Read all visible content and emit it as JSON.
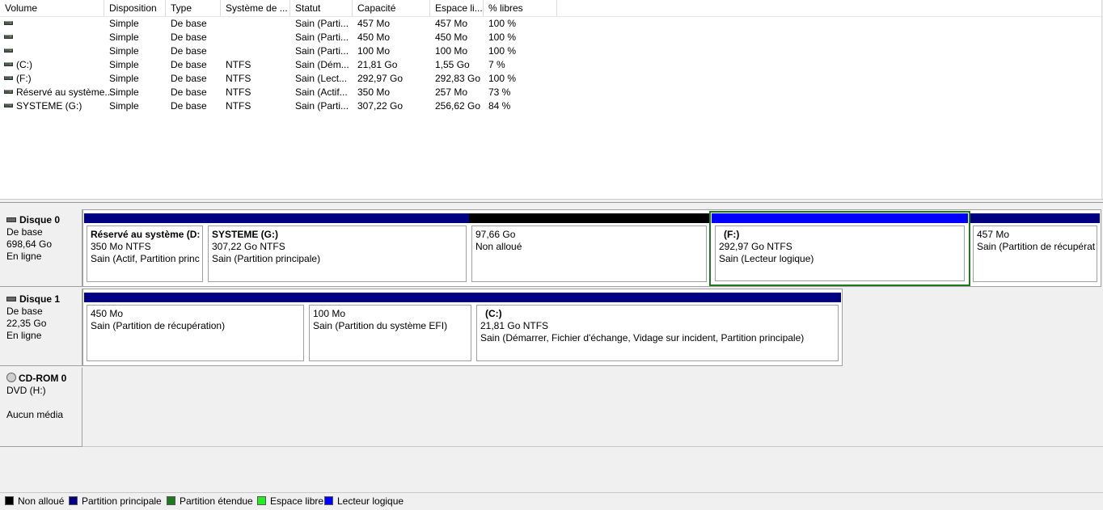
{
  "columns": [
    "Volume",
    "Disposition",
    "Type",
    "Système de ...",
    "Statut",
    "Capacité",
    "Espace li...",
    "% libres"
  ],
  "volumes": [
    {
      "volume": "",
      "disposition": "Simple",
      "type": "De base",
      "fs": "",
      "status": "Sain (Parti...",
      "capacity": "457 Mo",
      "free": "457 Mo",
      "pct": "100 %"
    },
    {
      "volume": "",
      "disposition": "Simple",
      "type": "De base",
      "fs": "",
      "status": "Sain (Parti...",
      "capacity": "450 Mo",
      "free": "450 Mo",
      "pct": "100 %"
    },
    {
      "volume": "",
      "disposition": "Simple",
      "type": "De base",
      "fs": "",
      "status": "Sain (Parti...",
      "capacity": "100 Mo",
      "free": "100 Mo",
      "pct": "100 %"
    },
    {
      "volume": "(C:)",
      "disposition": "Simple",
      "type": "De base",
      "fs": "NTFS",
      "status": "Sain (Dém...",
      "capacity": "21,81 Go",
      "free": "1,55 Go",
      "pct": "7 %"
    },
    {
      "volume": "(F:)",
      "disposition": "Simple",
      "type": "De base",
      "fs": "NTFS",
      "status": "Sain (Lect...",
      "capacity": "292,97 Go",
      "free": "292,83 Go",
      "pct": "100 %"
    },
    {
      "volume": "Réservé au système...",
      "disposition": "Simple",
      "type": "De base",
      "fs": "NTFS",
      "status": "Sain (Actif...",
      "capacity": "350 Mo",
      "free": "257 Mo",
      "pct": "73 %"
    },
    {
      "volume": "SYSTEME (G:)",
      "disposition": "Simple",
      "type": "De base",
      "fs": "NTFS",
      "status": "Sain (Parti...",
      "capacity": "307,22 Go",
      "free": "256,62 Go",
      "pct": "84 %"
    }
  ],
  "disks": [
    {
      "name": "Disque 0",
      "type": "De base",
      "size": "698,64 Go",
      "status": "En ligne",
      "partitions": [
        {
          "name": "Réservé au système  (D:",
          "line2": "350 Mo NTFS",
          "line3": "Sain (Actif, Partition princ",
          "kind": "primary"
        },
        {
          "name": "SYSTEME  (G:)",
          "line2": "307,22 Go NTFS",
          "line3": "Sain (Partition principale)",
          "kind": "primary"
        },
        {
          "name": "",
          "line2": "97,66 Go",
          "line3": "Non alloué",
          "kind": "unallocated"
        },
        {
          "name": "(F:)",
          "line2": "292,97 Go NTFS",
          "line3": "Sain (Lecteur logique)",
          "kind": "logical",
          "selected": true
        },
        {
          "name": "",
          "line2": "457 Mo",
          "line3": "Sain (Partition de récupérat",
          "kind": "primary"
        }
      ]
    },
    {
      "name": "Disque 1",
      "type": "De base",
      "size": "22,35 Go",
      "status": "En ligne",
      "partitions": [
        {
          "name": "",
          "line2": "450 Mo",
          "line3": "Sain (Partition de récupération)",
          "kind": "primary"
        },
        {
          "name": "",
          "line2": "100 Mo",
          "line3": "Sain (Partition du système EFI)",
          "kind": "primary"
        },
        {
          "name": "(C:)",
          "line2": "21,81 Go NTFS",
          "line3": "Sain (Démarrer, Fichier d'échange, Vidage sur incident, Partition principale)",
          "kind": "primary"
        }
      ]
    }
  ],
  "cdrom": {
    "name": "CD-ROM 0",
    "drive": "DVD (H:)",
    "status": "Aucun média"
  },
  "legend": [
    {
      "label": "Non alloué",
      "color": "#000000"
    },
    {
      "label": "Partition principale",
      "color": "#000080"
    },
    {
      "label": "Partition étendue",
      "color": "#1f7a1f"
    },
    {
      "label": "Espace libre",
      "color": "#22ee22"
    },
    {
      "label": "Lecteur logique",
      "color": "#0000ff"
    }
  ],
  "colors": {
    "primary": "#000080",
    "unallocated": "#000000",
    "logical": "#0000ff",
    "extended": "#1f7a1f",
    "free": "#22ee22"
  }
}
